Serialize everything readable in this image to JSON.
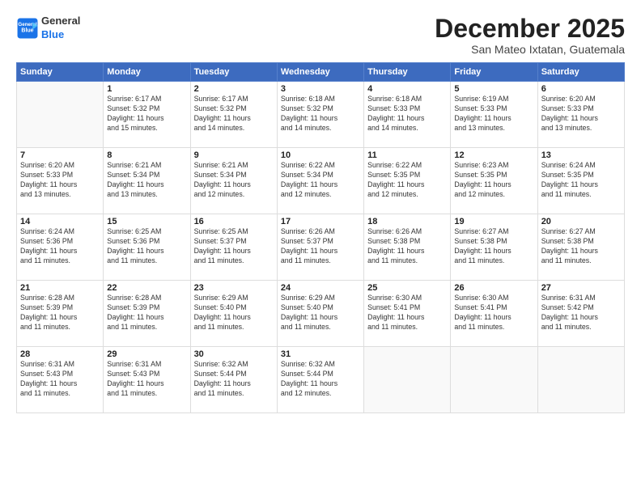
{
  "header": {
    "logo_line1": "General",
    "logo_line2": "Blue",
    "month": "December 2025",
    "location": "San Mateo Ixtatan, Guatemala"
  },
  "weekdays": [
    "Sunday",
    "Monday",
    "Tuesday",
    "Wednesday",
    "Thursday",
    "Friday",
    "Saturday"
  ],
  "weeks": [
    [
      {
        "day": "",
        "info": ""
      },
      {
        "day": "1",
        "info": "Sunrise: 6:17 AM\nSunset: 5:32 PM\nDaylight: 11 hours\nand 15 minutes."
      },
      {
        "day": "2",
        "info": "Sunrise: 6:17 AM\nSunset: 5:32 PM\nDaylight: 11 hours\nand 14 minutes."
      },
      {
        "day": "3",
        "info": "Sunrise: 6:18 AM\nSunset: 5:32 PM\nDaylight: 11 hours\nand 14 minutes."
      },
      {
        "day": "4",
        "info": "Sunrise: 6:18 AM\nSunset: 5:33 PM\nDaylight: 11 hours\nand 14 minutes."
      },
      {
        "day": "5",
        "info": "Sunrise: 6:19 AM\nSunset: 5:33 PM\nDaylight: 11 hours\nand 13 minutes."
      },
      {
        "day": "6",
        "info": "Sunrise: 6:20 AM\nSunset: 5:33 PM\nDaylight: 11 hours\nand 13 minutes."
      }
    ],
    [
      {
        "day": "7",
        "info": "Sunrise: 6:20 AM\nSunset: 5:33 PM\nDaylight: 11 hours\nand 13 minutes."
      },
      {
        "day": "8",
        "info": "Sunrise: 6:21 AM\nSunset: 5:34 PM\nDaylight: 11 hours\nand 13 minutes."
      },
      {
        "day": "9",
        "info": "Sunrise: 6:21 AM\nSunset: 5:34 PM\nDaylight: 11 hours\nand 12 minutes."
      },
      {
        "day": "10",
        "info": "Sunrise: 6:22 AM\nSunset: 5:34 PM\nDaylight: 11 hours\nand 12 minutes."
      },
      {
        "day": "11",
        "info": "Sunrise: 6:22 AM\nSunset: 5:35 PM\nDaylight: 11 hours\nand 12 minutes."
      },
      {
        "day": "12",
        "info": "Sunrise: 6:23 AM\nSunset: 5:35 PM\nDaylight: 11 hours\nand 12 minutes."
      },
      {
        "day": "13",
        "info": "Sunrise: 6:24 AM\nSunset: 5:35 PM\nDaylight: 11 hours\nand 11 minutes."
      }
    ],
    [
      {
        "day": "14",
        "info": "Sunrise: 6:24 AM\nSunset: 5:36 PM\nDaylight: 11 hours\nand 11 minutes."
      },
      {
        "day": "15",
        "info": "Sunrise: 6:25 AM\nSunset: 5:36 PM\nDaylight: 11 hours\nand 11 minutes."
      },
      {
        "day": "16",
        "info": "Sunrise: 6:25 AM\nSunset: 5:37 PM\nDaylight: 11 hours\nand 11 minutes."
      },
      {
        "day": "17",
        "info": "Sunrise: 6:26 AM\nSunset: 5:37 PM\nDaylight: 11 hours\nand 11 minutes."
      },
      {
        "day": "18",
        "info": "Sunrise: 6:26 AM\nSunset: 5:38 PM\nDaylight: 11 hours\nand 11 minutes."
      },
      {
        "day": "19",
        "info": "Sunrise: 6:27 AM\nSunset: 5:38 PM\nDaylight: 11 hours\nand 11 minutes."
      },
      {
        "day": "20",
        "info": "Sunrise: 6:27 AM\nSunset: 5:38 PM\nDaylight: 11 hours\nand 11 minutes."
      }
    ],
    [
      {
        "day": "21",
        "info": "Sunrise: 6:28 AM\nSunset: 5:39 PM\nDaylight: 11 hours\nand 11 minutes."
      },
      {
        "day": "22",
        "info": "Sunrise: 6:28 AM\nSunset: 5:39 PM\nDaylight: 11 hours\nand 11 minutes."
      },
      {
        "day": "23",
        "info": "Sunrise: 6:29 AM\nSunset: 5:40 PM\nDaylight: 11 hours\nand 11 minutes."
      },
      {
        "day": "24",
        "info": "Sunrise: 6:29 AM\nSunset: 5:40 PM\nDaylight: 11 hours\nand 11 minutes."
      },
      {
        "day": "25",
        "info": "Sunrise: 6:30 AM\nSunset: 5:41 PM\nDaylight: 11 hours\nand 11 minutes."
      },
      {
        "day": "26",
        "info": "Sunrise: 6:30 AM\nSunset: 5:41 PM\nDaylight: 11 hours\nand 11 minutes."
      },
      {
        "day": "27",
        "info": "Sunrise: 6:31 AM\nSunset: 5:42 PM\nDaylight: 11 hours\nand 11 minutes."
      }
    ],
    [
      {
        "day": "28",
        "info": "Sunrise: 6:31 AM\nSunset: 5:43 PM\nDaylight: 11 hours\nand 11 minutes."
      },
      {
        "day": "29",
        "info": "Sunrise: 6:31 AM\nSunset: 5:43 PM\nDaylight: 11 hours\nand 11 minutes."
      },
      {
        "day": "30",
        "info": "Sunrise: 6:32 AM\nSunset: 5:44 PM\nDaylight: 11 hours\nand 11 minutes."
      },
      {
        "day": "31",
        "info": "Sunrise: 6:32 AM\nSunset: 5:44 PM\nDaylight: 11 hours\nand 12 minutes."
      },
      {
        "day": "",
        "info": ""
      },
      {
        "day": "",
        "info": ""
      },
      {
        "day": "",
        "info": ""
      }
    ]
  ]
}
